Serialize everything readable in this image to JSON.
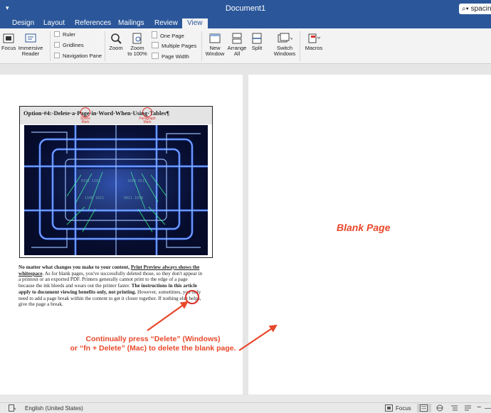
{
  "window": {
    "title": "Document1",
    "search_value": "spacing"
  },
  "tabs": [
    {
      "label": "Design"
    },
    {
      "label": "Layout"
    },
    {
      "label": "References"
    },
    {
      "label": "Mailings"
    },
    {
      "label": "Review"
    },
    {
      "label": "View"
    }
  ],
  "ribbon": {
    "focus": "Focus",
    "immersive_reader": [
      "Immersive",
      "Reader"
    ],
    "ruler": "Ruler",
    "gridlines": "Gridlines",
    "navigation_pane": "Navigation Pane",
    "zoom": "Zoom",
    "zoom_100": [
      "Zoom",
      "to 100%"
    ],
    "one_page": "One Page",
    "multiple_pages": "Multiple Pages",
    "page_width": "Page Width",
    "new_window": [
      "New",
      "Window"
    ],
    "arrange_all": [
      "Arrange",
      "All"
    ],
    "split": "Split",
    "switch_windows": [
      "Switch",
      "Windows"
    ],
    "macros": "Macros"
  },
  "document": {
    "figure_title": "Option·#4:·Delete·a·Page·in·Word·When·Using·Tables¶",
    "space_mark_label": [
      "Space",
      "Mark"
    ],
    "paragraph_mark_label": [
      "Paragraph",
      "Mark"
    ],
    "body": {
      "p1_bold": "No matter what changes you make to your content, ",
      "p1_link": "Print Preview always shows the whitespace",
      "p2": ". As for blank pages, you've successfully deleted those, so they don't appear in a printout or an exported PDF. Printers generally cannot print to the edge of a page because the ink bleeds and wears out the printer faster. ",
      "p3_bold": "The instructions in this article apply to document viewing benefits only, not printing.",
      "p4": " However, sometimes, you only need to add a page break within the content to get it closer together. If nothing else helps, give the page a break."
    },
    "blank_page_label": "Blank Page",
    "instruction_line1": "Continually press “Delete” (Windows)",
    "instruction_line2": "or “fn + Delete” (Mac) to delete the blank page."
  },
  "statusbar": {
    "language": "English (United States)",
    "focus": "Focus"
  },
  "colors": {
    "brand": "#2b579a",
    "annotation": "#e8482a",
    "circle": "#d9302a"
  }
}
